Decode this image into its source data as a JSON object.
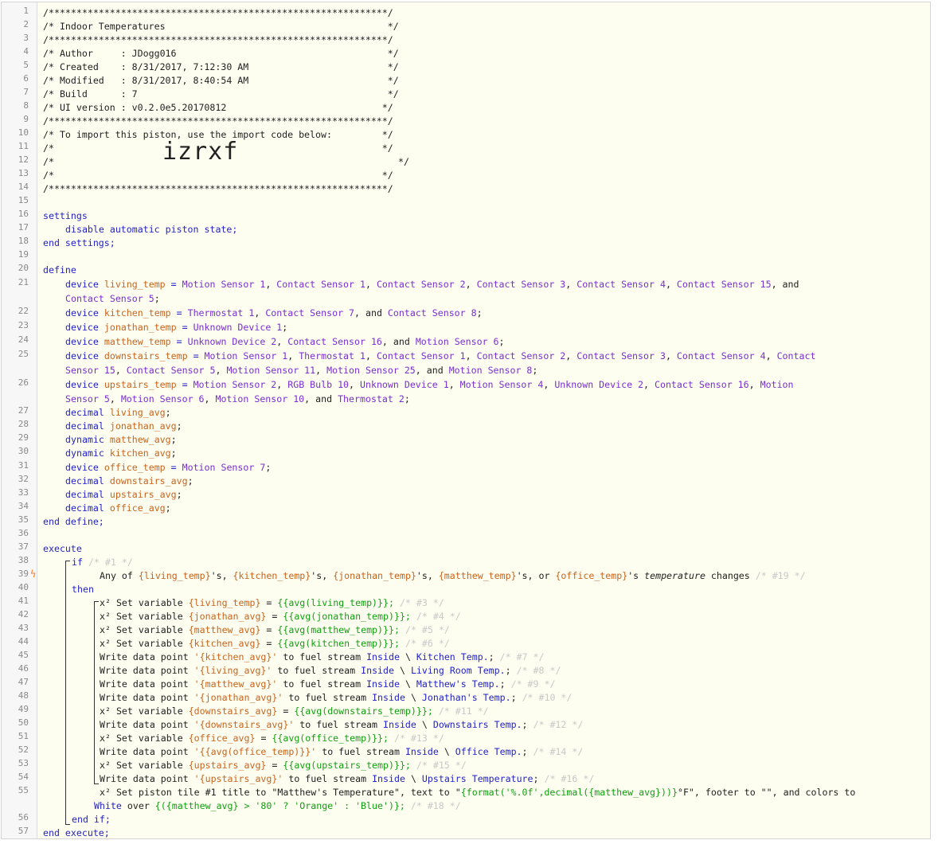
{
  "header": {
    "border": "/*************************************************************/",
    "title": "/* Indoor Temperatures                                        */",
    "author": "/* Author     : JDogg016                                      */",
    "created": "/* Created    : 8/31/2017, 7:12:30 AM                         */",
    "modified": "/* Modified   : 8/31/2017, 8:40:54 AM                         */",
    "build": "/* Build      : 7                                             */",
    "ui_version": "/* UI version : v0.2.0e5.20170812                            */",
    "import_hint": "/* To import this piston, use the import code below:         */",
    "blank": "/*                                                           */",
    "import_prefix": "/*",
    "import_code": "izrxf",
    "import_suffix": "*/"
  },
  "settings": {
    "open": "settings",
    "body": "disable automatic piston state;",
    "close": "end settings;"
  },
  "define": {
    "open": "define",
    "close": "end define;",
    "keyword_device": "device",
    "keyword_decimal": "decimal",
    "keyword_dynamic": "dynamic",
    "living_temp": "living_temp",
    "kitchen_temp": "kitchen_temp",
    "jonathan_temp": "jonathan_temp",
    "matthew_temp": "matthew_temp",
    "downstairs_temp": "downstairs_temp",
    "upstairs_temp": "upstairs_temp",
    "office_temp": "office_temp",
    "living_avg": "living_avg",
    "jonathan_avg": "jonathan_avg",
    "matthew_avg": "matthew_avg",
    "kitchen_avg": "kitchen_avg",
    "downstairs_avg": "downstairs_avg",
    "upstairs_avg": "upstairs_avg",
    "office_avg": "office_avg"
  },
  "devices": {
    "ms1": "Motion Sensor 1",
    "ms2": "Motion Sensor 2",
    "ms4": "Motion Sensor 4",
    "ms5": "Motion Sensor 5",
    "ms6": "Motion Sensor 6",
    "ms7": "Motion Sensor 7",
    "ms8": "Motion Sensor 8",
    "ms10": "Motion Sensor 10",
    "ms11": "Motion Sensor 11",
    "ms25": "Motion Sensor 25",
    "cs1": "Contact Sensor 1",
    "cs2": "Contact Sensor 2",
    "cs3": "Contact Sensor 3",
    "cs4": "Contact Sensor 4",
    "cs5": "Contact Sensor 5",
    "cs7": "Contact Sensor 7",
    "cs8": "Contact Sensor 8",
    "cs15": "Contact Sensor 15",
    "cs16": "Contact Sensor 16",
    "th1": "Thermostat 1",
    "th2": "Thermostat 2",
    "ud1": "Unknown Device 1",
    "ud2": "Unknown Device 2",
    "rgb10": "RGB Bulb 10"
  },
  "execute": {
    "open": "execute",
    "close": "end execute;",
    "if": "if",
    "then": "then",
    "end_if": "end if;",
    "c1": "/* #1 */",
    "any_of": "Any of",
    "cond_living": "{living_temp}",
    "cond_kitchen": "{kitchen_temp}",
    "cond_jonathan": "{jonathan_temp}",
    "cond_matthew": "{matthew_temp}",
    "cond_office": "{office_temp}",
    "temperature": "temperature",
    "changes": "changes",
    "c19": "/* #19 */"
  },
  "actions": [
    {
      "type": "set",
      "var": "{living_temp}",
      "expr": "{{avg(living_temp)}};",
      "comment": "/* #3 */"
    },
    {
      "type": "set",
      "var": "{jonathan_avg}",
      "expr": "{{avg(jonathan_temp)}};",
      "comment": "/* #4 */"
    },
    {
      "type": "set",
      "var": "{matthew_avg}",
      "expr": "{{avg(matthew_temp)}};",
      "comment": "/* #5 */"
    },
    {
      "type": "set",
      "var": "{kitchen_avg}",
      "expr": "{{avg(kitchen_temp)}};",
      "comment": "/* #6 */"
    },
    {
      "type": "write",
      "var": "'{kitchen_avg}'",
      "stream": "Inside",
      "name": "Kitchen Temp.",
      "comment": "/* #7 */"
    },
    {
      "type": "write",
      "var": "'{living_avg}'",
      "stream": "Inside",
      "name": "Living Room Temp.",
      "comment": "/* #8 */"
    },
    {
      "type": "write",
      "var": "'{matthew_avg}'",
      "stream": "Inside",
      "name": "Matthew's Temp.",
      "comment": "/* #9 */"
    },
    {
      "type": "write",
      "var": "'{jonathan_avg}'",
      "stream": "Inside",
      "name": "Jonathan's Temp.",
      "comment": "/* #10 */"
    },
    {
      "type": "set",
      "var": "{downstairs_avg}",
      "expr": "{{avg(downstairs_temp)}};",
      "comment": "/* #11 */"
    },
    {
      "type": "write",
      "var": "'{downstairs_avg}'",
      "stream": "Inside",
      "name": "Downstairs Temp.",
      "comment": "/* #12 */"
    },
    {
      "type": "set",
      "var": "{office_avg}",
      "expr": "{{avg(office_temp)}};",
      "comment": "/* #13 */"
    },
    {
      "type": "write",
      "var": "'{{avg(office_temp)}}'",
      "stream": "Inside",
      "name": "Office Temp.",
      "comment": "/* #14 */"
    },
    {
      "type": "set",
      "var": "{upstairs_avg}",
      "expr": "{{avg(upstairs_temp)}};",
      "comment": "/* #15 */"
    },
    {
      "type": "write",
      "var": "'{upstairs_avg}'",
      "stream": "Inside",
      "name": "Upstairs Temperature",
      "comment": "/* #16 */"
    }
  ],
  "words": {
    "set_variable": "x² Set variable",
    "write_data_point": "Write data point",
    "to_fuel_stream": "to fuel stream",
    "backslash": "\\",
    "semicolon": ";",
    "equals": "=",
    "and": "and"
  },
  "tile": {
    "prefix": "x² Set piston tile #1 title to",
    "title": "\"Matthew's Temperature\"",
    "text_to": ", text to",
    "text_open": "\"",
    "text_expr": "{format('%.0f',decimal({matthew_avg}))}",
    "text_close": "°F\"",
    "footer": ", footer to \"\", and colors to",
    "color_fg": "White",
    "over": "over",
    "color_bg": "{({matthew_avg} > '80' ? 'Orange' : 'Blue')};",
    "comment": "/* #18 */"
  },
  "colors": {
    "keyword": "#2323c8",
    "variable": "#c8641e",
    "device": "#7a2fd0",
    "expression": "#12a012",
    "comment": "#c8c8c8",
    "editor_bg": "#fdfdf0",
    "bolt": "#ff7a1e"
  },
  "icons": {
    "trigger": "lightning-bolt-icon"
  }
}
